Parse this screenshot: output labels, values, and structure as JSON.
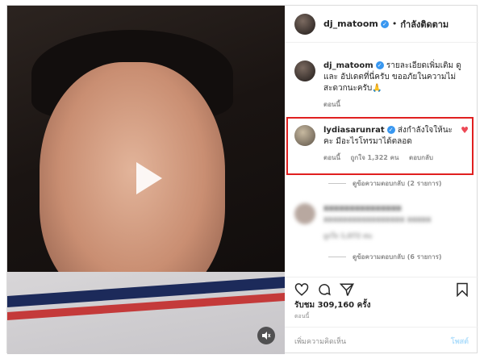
{
  "header": {
    "username": "dj_matoom",
    "separator": "•",
    "follow_label": "กำลังติดตาม"
  },
  "caption": {
    "username": "dj_matoom",
    "text": "รายละเอียดเพิ่มเติม ดูและ อัปเดตที่นี่ครับ ขออภัยในความไม่สะดวกนะครับ🙏",
    "time": "ตอนนี้"
  },
  "highlighted_comment": {
    "username": "lydiasarunrat",
    "text": "ส่งกำลังใจให้นะคะ มีอะไรโทรมาได้ตลอด",
    "time": "ตอนนี้",
    "likes": "ถูกใจ 1,322 คน",
    "reply": "ตอบกลับ",
    "view_replies": "ดูข้อความตอบกลับ (2 รายการ)"
  },
  "blurred_comment": {
    "username": "xxxxxxxxxxxxxxx",
    "text": "xxxxxxxxxxxxxxxxx xxxxx",
    "meta": "ถูกใจ 1,072 คน",
    "view_replies": "ดูข้อความตอบกลับ (6 รายการ)"
  },
  "stats": {
    "views": "รับชม 309,160 ครั้ง",
    "date": "ตอนนี้"
  },
  "add_comment": {
    "placeholder": "เพิ่มความคิดเห็น",
    "post_label": "โพสต์"
  },
  "icons": {
    "play": "play-icon",
    "mute": "speaker-mute-icon",
    "heart": "heart-icon",
    "comment": "comment-icon",
    "share": "share-icon",
    "bookmark": "bookmark-icon"
  },
  "colors": {
    "verified": "#3897f0",
    "liked_heart": "#ed4956",
    "highlight_box": "#e02020",
    "post_disabled": "#b2dffc"
  }
}
